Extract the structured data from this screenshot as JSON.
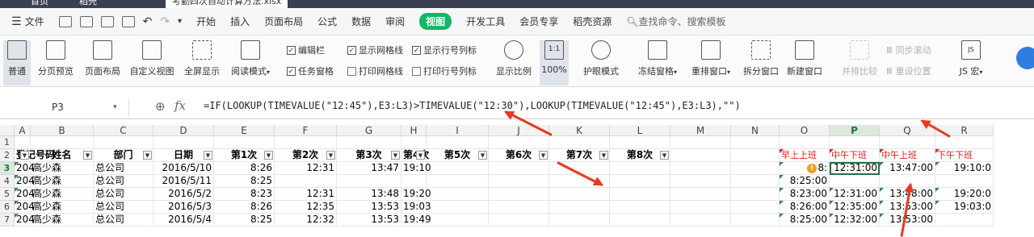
{
  "titlebar": {
    "tab_home": "首页",
    "tab_wps": "稻壳",
    "tab_doc": "考勤四次自动计算方法.xlsx"
  },
  "menu": {
    "file": "文件",
    "items": [
      "开始",
      "插入",
      "页面布局",
      "公式",
      "数据",
      "审阅",
      "视图",
      "开发工具",
      "会员专享",
      "稻壳资源"
    ],
    "active": "视图",
    "search": "查找命令、搜索模板"
  },
  "ribbon": {
    "normal": "普通",
    "page_break": "分页预览",
    "page_layout": "页面布局",
    "custom_view": "自定义视图",
    "fullscreen": "全屏显示",
    "reading": "阅读模式",
    "cb_editbar": "编辑栏",
    "cb_gridlines": "显示网格线",
    "cb_rowcol": "显示行号列标",
    "cb_taskpane": "任务窗格",
    "cb_print_grid": "打印网格线",
    "cb_print_rowcol": "打印行号列标",
    "zoom_ratio": "显示比例",
    "zoom_100": "100%",
    "zoom_box": "1:1",
    "eye": "护眼模式",
    "freeze": "冻结窗格",
    "rearrange": "重排窗口",
    "split": "拆分窗口",
    "new_window": "新建窗口",
    "side_by_side": "并排比较",
    "sync_scroll": "同步滚动",
    "reset_pos": "重设位置",
    "js_macro": "JS 宏"
  },
  "formula_bar": {
    "cell_ref": "P3",
    "fx": "fx",
    "formula": "=IF(LOOKUP(TIMEVALUE(\"12:45\"),E3:L3)>TIMEVALUE(\"12:30\"),LOOKUP(TIMEVALUE(\"12:45\"),E3:L3),\"\")"
  },
  "sheet": {
    "columns": [
      "A",
      "B",
      "C",
      "D",
      "E",
      "F",
      "G",
      "H",
      "I",
      "J",
      "K",
      "L",
      "M",
      "N",
      "O",
      "P",
      "Q",
      "R"
    ],
    "rows": [
      "1",
      "2",
      "3",
      "4",
      "5",
      "6",
      "7"
    ],
    "headers": [
      "登记号码",
      "姓名",
      "部门",
      "日期",
      "第1次",
      "第2次",
      "第3次",
      "第4次",
      "第5次",
      "第6次",
      "第7次",
      "第8次"
    ],
    "red_headers": [
      "早上上班",
      "中午下班",
      "中午上班",
      "下午下班"
    ],
    "data": [
      [
        "204",
        "高少森",
        "总公司",
        "2016/5/10",
        "8:26",
        "12:31",
        "13:47",
        "19:10",
        "8:",
        "12:31:00",
        "13:47:00",
        "19:10:0"
      ],
      [
        "204",
        "高少森",
        "总公司",
        "2016/5/11",
        "8:25",
        "",
        "",
        "",
        "8:25:00",
        "",
        "",
        ""
      ],
      [
        "204",
        "高少森",
        "总公司",
        "2016/5/2",
        "8:23",
        "12:31",
        "13:48",
        "19:20",
        "8:23:00",
        "12:31:00",
        "13:48:00",
        "19:20:0"
      ],
      [
        "204",
        "高少森",
        "总公司",
        "2016/5/3",
        "8:26",
        "12:35",
        "13:53",
        "19:03",
        "8:26:00",
        "12:35:00",
        "13:53:00",
        "19:03:0"
      ],
      [
        "204",
        "高少森",
        "总公司",
        "2016/5/4",
        "8:25",
        "12:32",
        "13:53",
        "19:49",
        "8:25:00",
        "12:32:00",
        "13:53:00",
        ""
      ]
    ]
  },
  "colors": {
    "accent": "#16b564",
    "header_red": "#e02020",
    "arrow": "#e83a1e",
    "selection": "#217346"
  }
}
